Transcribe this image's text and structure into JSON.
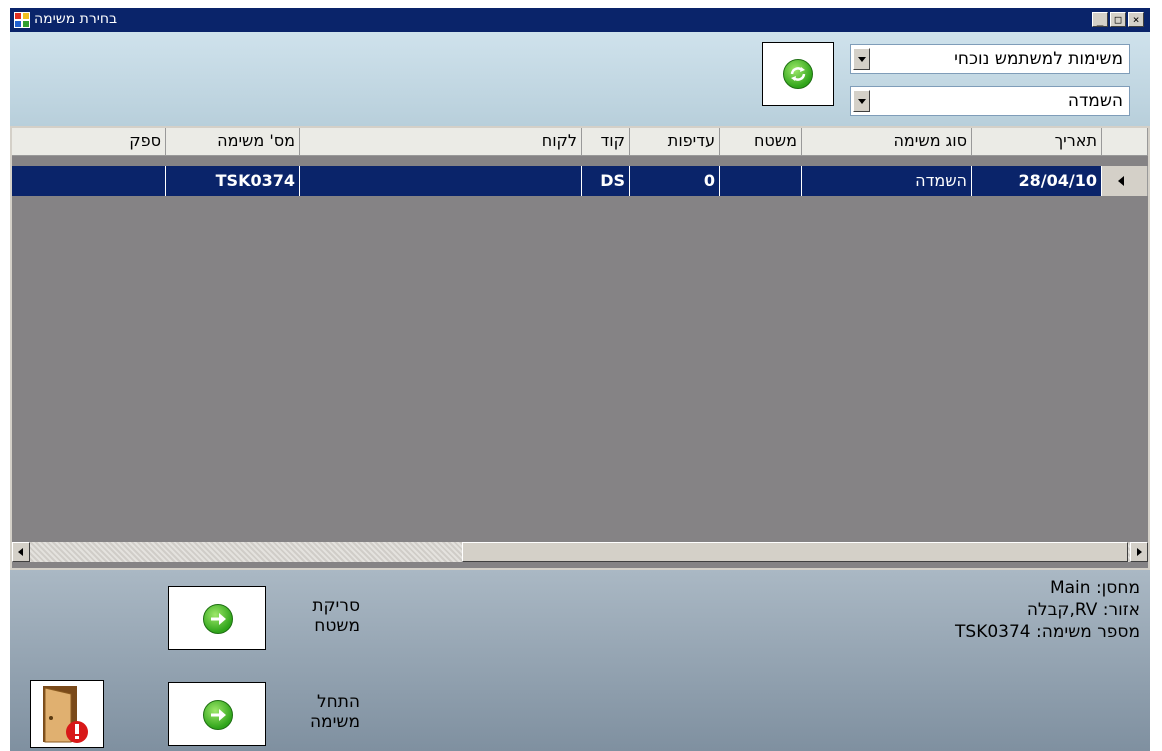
{
  "window": {
    "title": "בחירת משימה",
    "min_label": "_",
    "max_label": "□",
    "close_label": "×"
  },
  "filters": {
    "list_selected": "משימות למשתמש נוכחי",
    "type_selected": "השמדה"
  },
  "grid": {
    "columns": [
      "תאריך",
      "סוג משימה",
      "משטח",
      "עדיפות",
      "קוד",
      "לקוח",
      "מס' משימה",
      "ספק"
    ],
    "rows": [
      {
        "date": "28/04/10",
        "task_type": "השמדה",
        "pallet": "",
        "priority": "0",
        "code": "DS",
        "customer": "",
        "task_no": "TSK0374",
        "supplier": ""
      }
    ]
  },
  "info": {
    "warehouse": "מחסן: Main",
    "zone": "אזור: RV,קבלה",
    "task_number": "מספר משימה: TSK0374"
  },
  "actions": {
    "scan_line1": "סריקת",
    "scan_line2": "משטח",
    "start_line1": "התחל",
    "start_line2": "משימה"
  },
  "icons": {
    "refresh": "refresh-icon",
    "arrow": "green-arrow-icon",
    "exit": "exit-door-icon"
  },
  "colors": {
    "titlebar": "#0a246a",
    "selected_row": "#0a246a",
    "grid_bg": "#858385"
  }
}
